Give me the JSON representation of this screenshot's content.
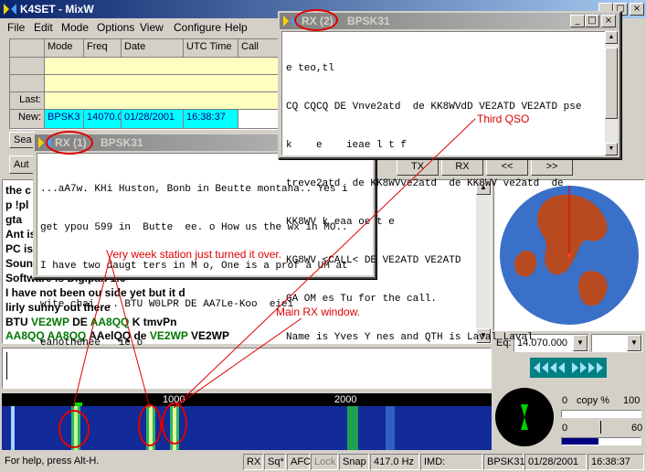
{
  "app": {
    "title": "K4SET - MixW"
  },
  "menu": [
    "File",
    "Edit",
    "Mode",
    "Options",
    "View",
    "Configure",
    "Help"
  ],
  "log": {
    "columns": [
      "Mode",
      "Freq",
      "Date",
      "UTC Time",
      "Call"
    ],
    "row_labels": [
      "",
      "",
      "Last:",
      "New:"
    ],
    "new_row": [
      "BPSK3",
      "14070.0",
      "01/28/2001",
      "16:38:37",
      ""
    ]
  },
  "buttons": {
    "search": "Sea",
    "auto": "Aut",
    "tx": "TX",
    "rx": "RX",
    "back": "<<",
    "fwd": ">>"
  },
  "rx1": {
    "title": "RX (1)",
    "mode": "BPSK31",
    "lines": [
      "...aA7w. KHi Huston, Bonb in Beutte montana.. Yes i",
      "get ypou 599 in  Butte  ee. o How us the wx in MO..",
      "I have two daugt ters in M o, One is a prof a UM at",
      "wite chai  .. BTU W0LPR DE AA7Le-Koo  eiei",
      "eanothehee   ie o"
    ]
  },
  "rx2": {
    "title": "RX (2)",
    "mode": "BPSK31",
    "lines": [
      "e teo,tl",
      "CQ CQCQ DE Vnve2atd  de KK8WVdD VE2ATD VE2ATD pse",
      "k    e    ieae l t f",
      "treve2atd  de KK8WVve2atd  de KK8WV ve2atd  de",
      "KK8WV k eaa oe t e",
      "KG8WV <CALL< DE VE2ATD VE2ATD",
      "GA OM es Tu for the call.",
      "Name is Yves Y nes and QTH is Laval Laval"
    ]
  },
  "main_rx": {
    "lines": [
      "the c",
      "p  !pl",
      "   gta",
      "Ant is",
      "PC is",
      "Soun",
      "Software is Digipan 1.6",
      "I have not been ou side yet but it  d",
      "lirly sunny out there"
    ],
    "line_btu": {
      "a": "BTU ",
      "b": "VE2WP",
      "c": " DE ",
      "d": "AA8QQ",
      "e": " K  tmvPn"
    },
    "line_aa": {
      "a": "AA8QQ AA8QQ",
      "b": " AAelQQ de ",
      "c": "VE2WP",
      "d": " VE2WP"
    }
  },
  "annotations": {
    "weak": "Very week station just turned it over.",
    "main": "Main RX window.",
    "third": "Third QSO"
  },
  "side": {
    "eq_label": "Eq:",
    "freq_value": "14.070.000",
    "copy_label": "copy %",
    "copy_min": "0",
    "copy_max": "100",
    "sq_min": "0",
    "sq_max": "60"
  },
  "waterfall": {
    "tick1": "1000",
    "tick2": "2000"
  },
  "status": {
    "help": "For help, press Alt-H.",
    "rx": "RX",
    "sq": "Sq*",
    "afc": "AFC",
    "lock": "Lock",
    "snap": "Snap",
    "freq": "417.0 Hz",
    "imd": "IMD:",
    "mode": "BPSK31",
    "date": "01/28/2001",
    "time": "16:38:37"
  },
  "colors": {
    "title_active": "#0a246a",
    "annotation": "#e00000",
    "call_green": "#007700",
    "waterfall": "#0b1f8a"
  }
}
